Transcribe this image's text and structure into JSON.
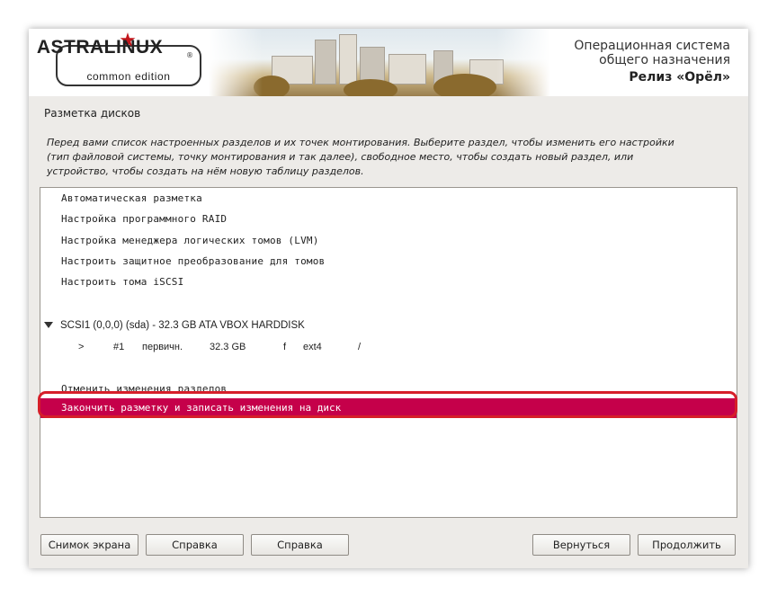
{
  "header": {
    "logo": {
      "title": "ASTRALINUX",
      "registered": "®",
      "subtitle": "common edition",
      "star_color": "#c4161c"
    },
    "os_title_line1": "Операционная система",
    "os_title_line2": "общего назначения",
    "release": "Релиз «Орёл»"
  },
  "page": {
    "title": "Разметка дисков",
    "description_line1": "Перед вами список настроенных разделов и их точек монтирования. Выберите раздел, чтобы изменить его настройки",
    "description_line2": "(тип файловой системы, точку монтирования и так далее), свободное место, чтобы создать новый раздел, или",
    "description_line3": "устройство, чтобы создать на нём новую таблицу разделов."
  },
  "list": {
    "items": [
      "Автоматическая разметка",
      "Настройка программного RAID",
      "Настройка менеджера логических томов (LVM)",
      "Настроить защитное преобразование для томов",
      "Настроить тома iSCSI"
    ],
    "disk": "SCSI1 (0,0,0) (sda) - 32.3 GB ATA VBOX HARDDISK",
    "partition": {
      "marker": ">",
      "number": "#1",
      "type": "первичн.",
      "size": "32.3 GB",
      "flag": "f",
      "fs": "ext4",
      "mount": "/"
    },
    "undo": "Отменить изменения разделов",
    "finish": "Закончить разметку и записать изменения на диск",
    "selected_color": "#c5004a",
    "highlight_color": "#d61f2a"
  },
  "buttons": {
    "screenshot": "Снимок экрана",
    "help1": "Справка",
    "help2": "Справка",
    "back": "Вернуться",
    "continue": "Продолжить"
  }
}
